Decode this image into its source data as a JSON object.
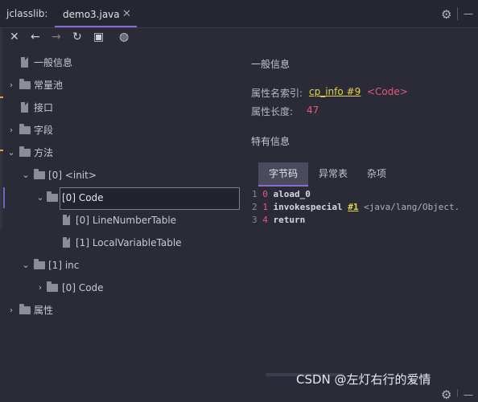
{
  "tabs": {
    "tool_label": "jclasslib:",
    "active_label": "demo3.java",
    "close_glyph": "✕"
  },
  "toolbar": [
    "close-icon",
    "back-icon",
    "forward-icon",
    "refresh-icon",
    "save-icon",
    "web-icon"
  ],
  "tree": {
    "general": "一般信息",
    "constant_pool": "常量池",
    "interfaces": "接口",
    "fields": "字段",
    "methods": "方法",
    "method0": "[0] <init>",
    "code0": "[0] Code",
    "lnt": "[0] LineNumberTable",
    "lvt": "[1] LocalVariableTable",
    "method1": "[1] inc",
    "code1": "[0] Code",
    "attributes": "属性"
  },
  "detail": {
    "general_title": "一般信息",
    "name_index_label": "属性名索引:",
    "name_index_link": "cp_info #9",
    "name_index_value": "<Code>",
    "length_label": "属性长度:",
    "length_value": "47",
    "specific_title": "特有信息"
  },
  "code_tabs": [
    "字节码",
    "异常表",
    "杂项"
  ],
  "bytecode": [
    {
      "line": "1",
      "offset": "0",
      "op": "aload_0",
      "arg": "",
      "comment": ""
    },
    {
      "line": "2",
      "offset": "1",
      "op": "invokespecial",
      "arg": "#1",
      "comment": "<java/lang/Object."
    },
    {
      "line": "3",
      "offset": "4",
      "op": "return",
      "arg": "",
      "comment": ""
    }
  ],
  "watermark": "CSDN @左灯右行的爱情",
  "colors": {
    "accent": "#8a6cd6",
    "link": "#e6d44a",
    "value": "#e8577f",
    "background": "#2b2b37"
  }
}
